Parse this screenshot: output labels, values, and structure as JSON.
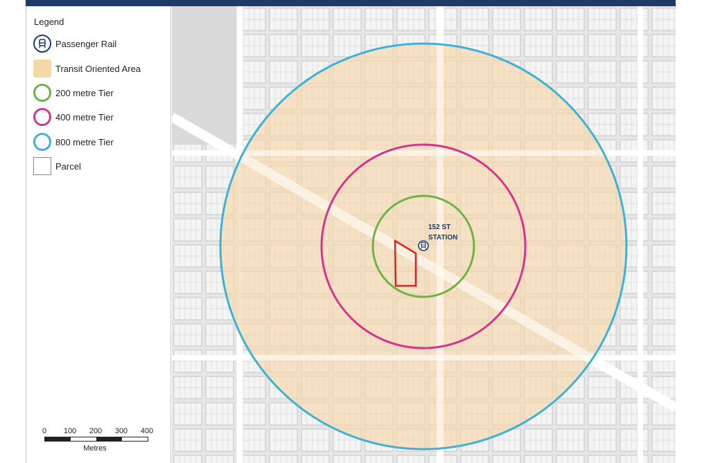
{
  "legend": {
    "title": "Legend",
    "items": [
      {
        "label": "Passenger Rail",
        "icon": "train-icon",
        "color": "#1f3a68"
      },
      {
        "label": "Transit Oriented Area",
        "icon": "area-swatch",
        "color": "#f6d7a8"
      },
      {
        "label": "200 metre Tier",
        "icon": "ring-swatch",
        "color": "#6cb33f"
      },
      {
        "label": "400 metre Tier",
        "icon": "ring-swatch",
        "color": "#d6338f"
      },
      {
        "label": "800 metre Tier",
        "icon": "ring-swatch",
        "color": "#3eb1d6"
      },
      {
        "label": "Parcel",
        "icon": "parcel-swatch",
        "color": "#888888"
      }
    ]
  },
  "scalebar": {
    "ticks": [
      "0",
      "100",
      "200",
      "300",
      "400"
    ],
    "unit": "Metres"
  },
  "map": {
    "station_label_line1": "152 ST",
    "station_label_line2": "STATION",
    "colors": {
      "toa_fill": "#f6d7a8",
      "ring_200": "#6cb33f",
      "ring_400": "#d6338f",
      "ring_800": "#3eb1d6",
      "subject_parcel": "#e02020",
      "rail_station": "#1f3a68"
    }
  }
}
